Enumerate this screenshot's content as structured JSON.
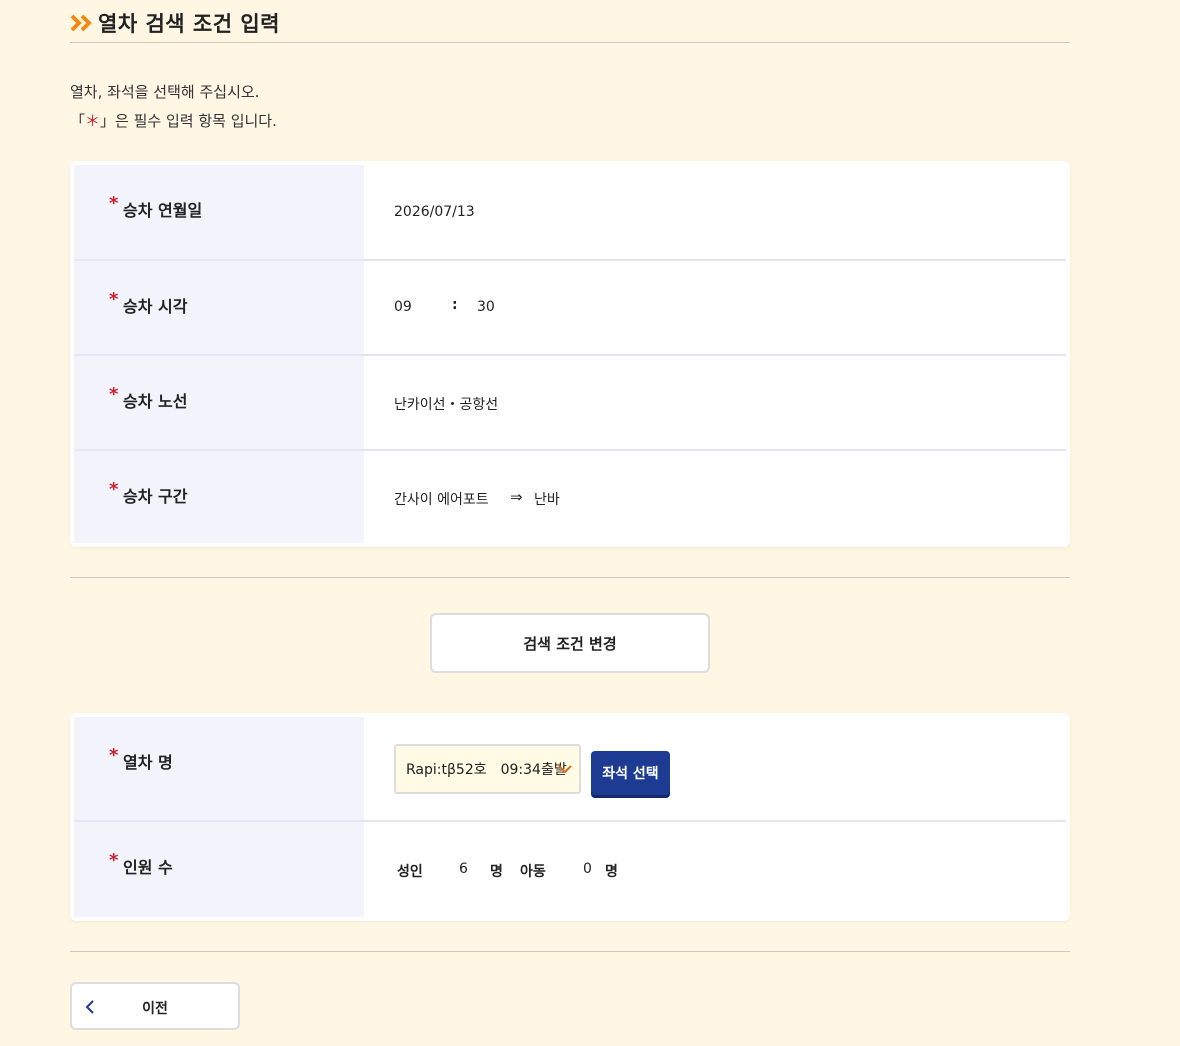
{
  "heading": {
    "title": "열차 검색 조건 입력"
  },
  "intro": {
    "line1": "열차, 좌석을 선택해 주십시오.",
    "line2_prefix": "「",
    "line2_star": "＊",
    "line2_suffix": "」은 필수 입력 항목 입니다."
  },
  "search": {
    "required_mark": "*",
    "date": {
      "label": "승차 연월일",
      "value": "2026/07/13"
    },
    "time": {
      "label": "승차 시각",
      "hour": "09",
      "separator": ":",
      "minute": "30"
    },
    "line": {
      "label": "승차 노선",
      "value": "난카이선・공항선"
    },
    "section": {
      "label": "승차 구간",
      "from": "간사이 에어포트",
      "arrow": "⇒",
      "to": "난바"
    }
  },
  "change_button": "검색 조건 변경",
  "train": {
    "label": "열차 명",
    "selected": "Rapi:tβ52호　09:34출발",
    "seat_button": "좌석 선택"
  },
  "passengers": {
    "label": "인원 수",
    "adult_label": "성인",
    "adult_count": "6",
    "unit": "명",
    "child_label": "아동",
    "child_count": "0"
  },
  "back_button": "이전",
  "colors": {
    "background": "#fff6e3",
    "accent_orange": "#ef8a12",
    "required_red": "#d0202a",
    "primary_blue": "#1e3b94",
    "label_bg": "#f3f4fb"
  }
}
